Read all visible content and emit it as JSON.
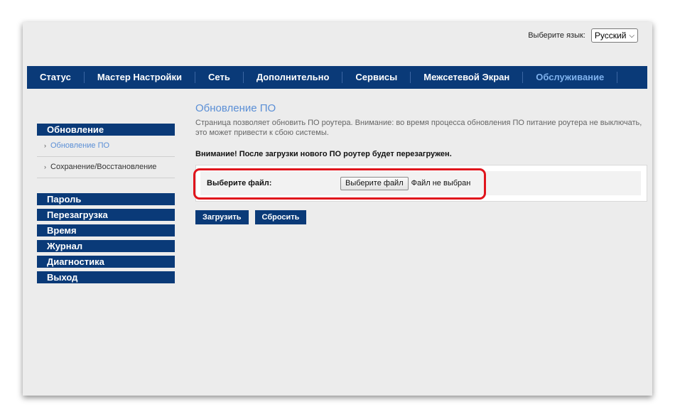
{
  "language": {
    "label": "Выберите язык:",
    "selected": "Русский"
  },
  "topnav": {
    "items": [
      {
        "label": "Статус"
      },
      {
        "label": "Мастер Настройки"
      },
      {
        "label": "Сеть"
      },
      {
        "label": "Дополнительно"
      },
      {
        "label": "Сервисы"
      },
      {
        "label": "Межсетевой Экран"
      },
      {
        "label": "Обслуживание"
      }
    ],
    "active": "Обслуживание"
  },
  "sidebar": {
    "section_title": "Обновление",
    "sub_items": [
      {
        "label": "Обновление ПО"
      },
      {
        "label": "Сохранение/Восстановление"
      }
    ],
    "groups": [
      {
        "label": "Пароль"
      },
      {
        "label": "Перезагрузка"
      },
      {
        "label": "Время"
      },
      {
        "label": "Журнал"
      },
      {
        "label": "Диагностика"
      },
      {
        "label": "Выход"
      }
    ]
  },
  "main": {
    "title": "Обновление ПО",
    "description": "Страница позволяет обновить ПО роутера. Внимание: во время процесса обновления ПО питание роутера не выключать, это может привести к сбою системы.",
    "warning": "Внимание! После загрузки нового ПО роутер будет перезагружен.",
    "file_label": "Выберите файл:",
    "file_button": "Выберите файл",
    "file_status": "Файл не выбран",
    "upload_button": "Загрузить",
    "reset_button": "Сбросить"
  },
  "colors": {
    "nav_bg": "#0a3a78",
    "accent": "#5b8fd6",
    "highlight": "#e0141c"
  }
}
